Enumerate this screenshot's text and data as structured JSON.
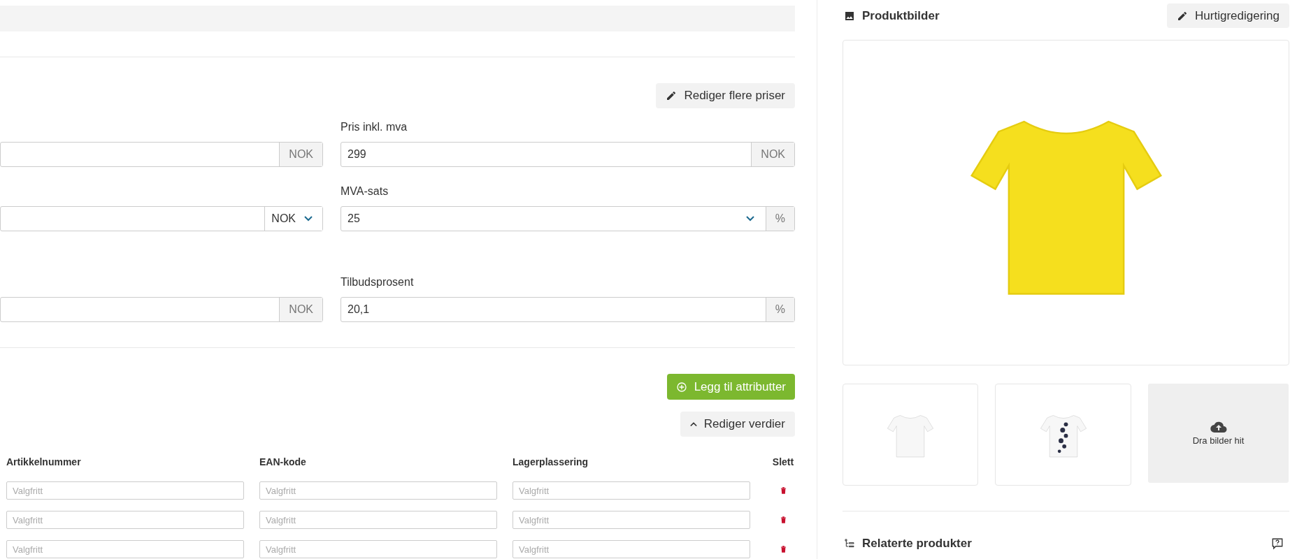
{
  "prices": {
    "edit_button": "Rediger flere priser",
    "rows": [
      [
        {
          "kind": "input",
          "addon": {
            "kind": "text",
            "text": "NOK"
          }
        },
        {
          "kind": "input",
          "label": "Pris inkl. mva",
          "value": "299",
          "addon": {
            "kind": "text",
            "text": "NOK"
          }
        }
      ],
      [
        {
          "kind": "input",
          "addon": {
            "kind": "select",
            "text": "NOK"
          }
        },
        {
          "kind": "select",
          "label": "MVA-sats",
          "value": "25",
          "addon": {
            "kind": "text",
            "text": "%"
          }
        }
      ],
      [
        {
          "kind": "input",
          "addon": {
            "kind": "text",
            "text": "NOK"
          }
        },
        {
          "kind": "input",
          "label": "Tilbudsprosent",
          "value": "20,1",
          "addon": {
            "kind": "text",
            "text": "%"
          }
        }
      ]
    ]
  },
  "attributes": {
    "add_button": "Legg til attributter",
    "edit_values_button": "Rediger verdier",
    "columns": [
      "Artikkelnummer",
      "EAN-kode",
      "Lagerplassering",
      "Slett"
    ],
    "rows": [
      {
        "placeholders": [
          "Valgfritt",
          "Valgfritt",
          "Valgfritt"
        ]
      },
      {
        "placeholders": [
          "Valgfritt",
          "Valgfritt",
          "Valgfritt"
        ]
      },
      {
        "placeholders": [
          "Valgfritt",
          "Valgfritt",
          "Valgfritt"
        ]
      }
    ]
  },
  "images": {
    "title": "Produktbilder",
    "quick_edit_button": "Hurtigredigering",
    "main": {
      "kind": "yellow"
    },
    "thumbnails": [
      {
        "kind": "plain"
      },
      {
        "kind": "printed"
      }
    ],
    "dropzone": "Dra bilder hit"
  },
  "related": {
    "title": "Relaterte produkter"
  }
}
